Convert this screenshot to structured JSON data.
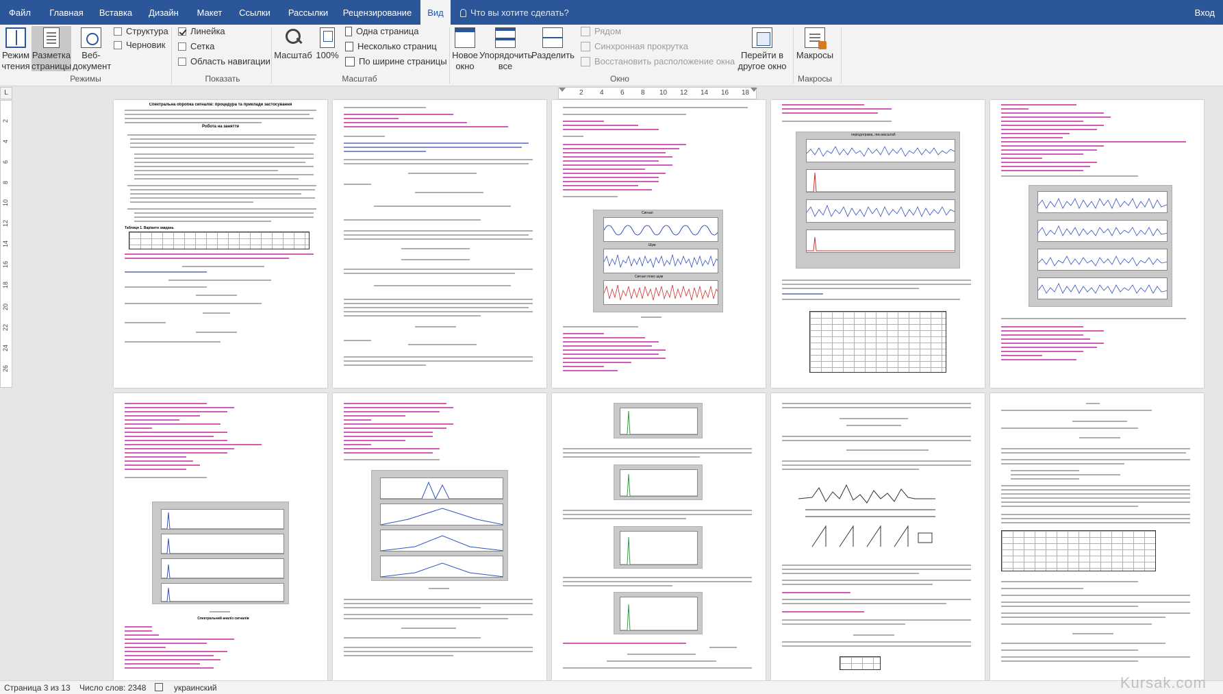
{
  "menu": {
    "tabs": [
      "Файл",
      "Главная",
      "Вставка",
      "Дизайн",
      "Макет",
      "Ссылки",
      "Рассылки",
      "Рецензирование",
      "Вид"
    ],
    "active_tab": "Вид",
    "tell_me": "Что вы хотите сделать?",
    "sign_in": "Вход"
  },
  "ribbon": {
    "modes": {
      "read_mode": "Режим\nчтения",
      "print_layout": "Разметка\nстраницы",
      "web_layout": "Веб-\nдокумент",
      "outline": "Структура",
      "draft": "Черновик",
      "group_label": "Режимы"
    },
    "show": {
      "ruler": "Линейка",
      "ruler_checked": true,
      "gridlines": "Сетка",
      "gridlines_checked": false,
      "nav_pane": "Область навигации",
      "nav_pane_checked": false,
      "group_label": "Показать"
    },
    "zoom": {
      "zoom": "Масштаб",
      "hundred": "100%",
      "one_page": "Одна страница",
      "multiple_pages": "Несколько страниц",
      "page_width": "По ширине страницы",
      "group_label": "Масштаб"
    },
    "window": {
      "new_window": "Новое\nокно",
      "arrange_all": "Упорядочить\nвсе",
      "split": "Разделить",
      "side_by_side": "Рядом",
      "sync_scroll": "Синхронная прокрутка",
      "reset_position": "Восстановить расположение окна",
      "switch_windows": "Перейти в\nдругое окно",
      "group_label": "Окно"
    },
    "macros": {
      "macros": "Макросы",
      "group_label": "Макросы"
    }
  },
  "ruler": {
    "corner": "L",
    "h_numbers": [
      "2",
      "4",
      "6",
      "8",
      "10",
      "12",
      "14",
      "16",
      "18"
    ],
    "v_numbers": [
      "2",
      "4",
      "6",
      "8",
      "10",
      "12",
      "14",
      "16",
      "18",
      "20",
      "22",
      "24",
      "26"
    ]
  },
  "document": {
    "page1_title": "Спектральна обробка сигналів: процедура та приклади застосування",
    "page1_subtitle": "Робота на заняття",
    "figure_titles": {
      "periodogram": "періодограма, лин.масштаб",
      "signal": "Сигнал",
      "noise": "Шум",
      "signal_noise": "Сигнал плюс шум"
    },
    "section_heading": "Спектральний аналіз сигналів",
    "tab_label": "Таблиця 1. Варіанти завдань"
  },
  "status": {
    "page": "Страница 3 из 13",
    "words": "Число слов: 2348",
    "language": "украинский"
  },
  "watermark": "Kursak.com"
}
